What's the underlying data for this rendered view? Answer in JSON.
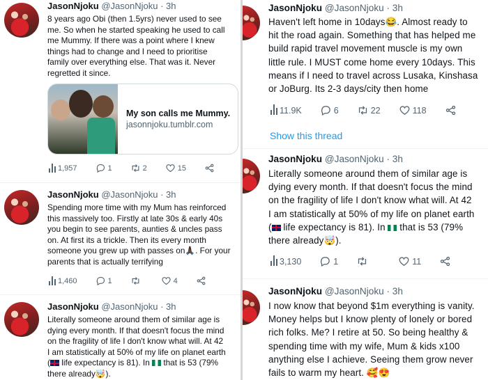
{
  "left": {
    "tweets": [
      {
        "author": "JasonNjoku",
        "handle": "@JasonNjoku",
        "time": "· 3h",
        "lines": [
          "8 years ago Obi (then 1.5yrs) never used to see",
          "me. So when he started speaking he used to call",
          "me Mummy. If there was a point where I knew",
          "things had to change and I need to prioritise",
          "family over everything else. That was it. Never",
          "regretted it since."
        ],
        "card": {
          "title": "My son calls me Mummy.",
          "domain": "jasonnjoku.tumblr.com"
        },
        "views": "1,957",
        "replies": "1",
        "retweets": "2",
        "likes": "15"
      },
      {
        "author": "JasonNjoku",
        "handle": "@JasonNjoku",
        "time": "· 3h",
        "lines": [
          "Spending more time with my Mum has reinforced",
          "this massively too. Firstly at late 30s & early 40s",
          "you begin to see parents, aunties & uncles pass",
          "on. At first its a trickle. Then its every month",
          "someone you grew up with passes on🙏🏿. For your",
          "parents that is actually terrifying"
        ],
        "views": "1,460",
        "replies": "1",
        "retweets": "",
        "likes": "4"
      },
      {
        "author": "JasonNjoku",
        "handle": "@JasonNjoku",
        "time": "· 3h",
        "lines": [
          "Literally someone around them of similar age is",
          "dying every month. If that doesn't focus the mind",
          "on the fragility of life I don't know what will. At 42",
          "I am statistically at 50% of my life on planet earth"
        ],
        "line5_a": "(",
        "line5_b": " life expectancy is 81). In ",
        "line5_c": " that is 53 (79%",
        "line6": "there already🤯)."
      }
    ]
  },
  "right": {
    "tweets": [
      {
        "author": "JasonNjoku",
        "handle": "@JasonNjoku",
        "time": "· 3h",
        "lines": [
          "Haven't left home in 10days😂. Almost ready to",
          "hit the road again. Something that has helped me",
          "build rapid travel movement muscle is my own",
          "little rule. I MUST come home every 10days. This",
          "means if I need to travel across Lusaka, Kinshasa",
          "or JoBurg. Its 2-3 days/city then home"
        ],
        "views": "11.9K",
        "replies": "6",
        "retweets": "22",
        "likes": "118",
        "show_thread": "Show this thread"
      },
      {
        "author": "JasonNjoku",
        "handle": "@JasonNjoku",
        "time": "· 3h",
        "lines": [
          "Literally someone around them of similar age is",
          "dying every month. If that doesn't focus the mind",
          "on the fragility of life I don't know what will. At 42",
          "I am statistically at 50% of my life on planet earth"
        ],
        "line5_a": "(",
        "line5_b": " life expectancy is 81). In ",
        "line5_c": " that is 53 (79%",
        "line6": "there already🤯).",
        "views": "3,130",
        "replies": "1",
        "retweets": "",
        "likes": "11"
      },
      {
        "author": "JasonNjoku",
        "handle": "@JasonNjoku",
        "time": "· 3h",
        "lines": [
          "I now know that beyond $1m everything is vanity.",
          "Money helps but I know plenty of lonely or bored",
          "rich folks. Me? I retire at 50. So being healthy &",
          "spending time with my wife, Mum & kids x100",
          "anything else I achieve. Seeing them grow never",
          "fails to warm my heart. 🥰😍"
        ]
      }
    ]
  }
}
